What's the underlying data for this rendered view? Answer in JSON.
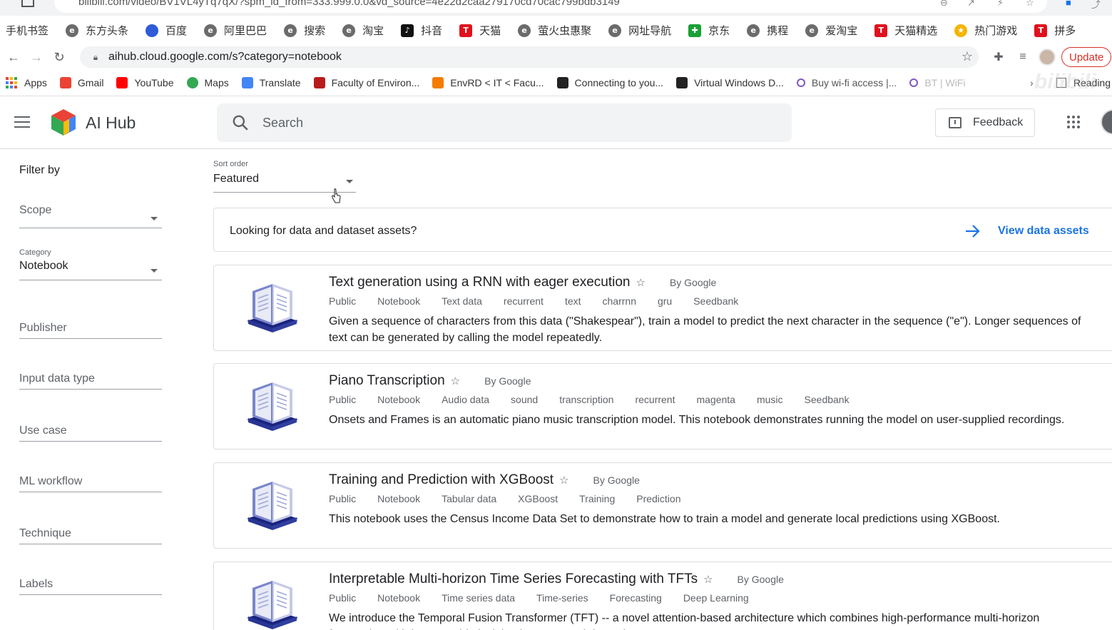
{
  "browser": {
    "prev_tab_url": "bilibili.com/video/BV1VL4yTq7qX/?spm_id_from=333.999.0.0&vd_source=4e22d2caa279170cd70cac799bdb3149",
    "cn_bookmarks": [
      {
        "label": "手机书签",
        "icon": "none"
      },
      {
        "label": "东方头条",
        "icon": "gray"
      },
      {
        "label": "百度",
        "icon": "blue"
      },
      {
        "label": "阿里巴巴",
        "icon": "gray"
      },
      {
        "label": "搜索",
        "icon": "gray"
      },
      {
        "label": "淘宝",
        "icon": "gray"
      },
      {
        "label": "抖音",
        "icon": "black"
      },
      {
        "label": "天猫",
        "icon": "red"
      },
      {
        "label": "萤火虫惠聚",
        "icon": "gray"
      },
      {
        "label": "网址导航",
        "icon": "gray"
      },
      {
        "label": "京东",
        "icon": "green"
      },
      {
        "label": "携程",
        "icon": "gray"
      },
      {
        "label": "爱淘宝",
        "icon": "gray"
      },
      {
        "label": "天猫精选",
        "icon": "red"
      },
      {
        "label": "热门游戏",
        "icon": "yellow"
      },
      {
        "label": "拼多",
        "icon": "red"
      }
    ],
    "address": "aihub.cloud.google.com/s?category=notebook",
    "update_label": "Update",
    "bookmarks": [
      {
        "label": "Apps",
        "icon": "apps"
      },
      {
        "label": "Gmail",
        "icon": "gmail"
      },
      {
        "label": "YouTube",
        "icon": "youtube"
      },
      {
        "label": "Maps",
        "icon": "maps"
      },
      {
        "label": "Translate",
        "icon": "translate"
      },
      {
        "label": "Faculty of Environ...",
        "icon": "faculty"
      },
      {
        "label": "EnvRD < IT < Facu...",
        "icon": "envrd"
      },
      {
        "label": "Connecting to you...",
        "icon": "connecting"
      },
      {
        "label": "Virtual Windows D...",
        "icon": "virtual"
      },
      {
        "label": "Buy wi-fi access |...",
        "icon": "wifi"
      },
      {
        "label": "BT | WiFi",
        "icon": "bt"
      }
    ],
    "reading_list": "Reading"
  },
  "header": {
    "app_title": "AI Hub",
    "search_placeholder": "Search",
    "feedback_label": "Feedback"
  },
  "filters": {
    "title": "Filter by",
    "scope": "Scope",
    "category_caption": "Category",
    "category_value": "Notebook",
    "publisher": "Publisher",
    "input_data_type": "Input data type",
    "use_case": "Use case",
    "ml_workflow": "ML workflow",
    "technique": "Technique",
    "labels": "Labels"
  },
  "sort": {
    "caption": "Sort order",
    "value": "Featured"
  },
  "banner": {
    "question": "Looking for data and dataset assets?",
    "link": "View data assets"
  },
  "assets": [
    {
      "title": "Text generation using a RNN with eager execution",
      "by": "By Google",
      "tags": [
        "Public",
        "Notebook",
        "Text data",
        "recurrent",
        "text",
        "charrnn",
        "gru",
        "Seedbank"
      ],
      "description": "Given a sequence of characters from this data (\"Shakespear\"), train a model to predict the next character in the sequence (\"e\"). Longer sequences of text can be generated by calling the model repeatedly."
    },
    {
      "title": "Piano Transcription",
      "by": "By Google",
      "tags": [
        "Public",
        "Notebook",
        "Audio data",
        "sound",
        "transcription",
        "recurrent",
        "magenta",
        "music",
        "Seedbank"
      ],
      "description": "Onsets and Frames is an automatic piano music transcription model. This notebook demonstrates running the model on user-supplied recordings."
    },
    {
      "title": "Training and Prediction with XGBoost",
      "by": "By Google",
      "tags": [
        "Public",
        "Notebook",
        "Tabular data",
        "XGBoost",
        "Training",
        "Prediction"
      ],
      "description": "This notebook uses the Census Income Data Set to demonstrate how to train a model and generate local predictions using XGBoost."
    },
    {
      "title": "Interpretable Multi-horizon Time Series Forecasting with TFTs",
      "by": "By Google",
      "tags": [
        "Public",
        "Notebook",
        "Time series data",
        "Time-series",
        "Forecasting",
        "Deep Learning"
      ],
      "description": "We introduce the Temporal Fusion Transformer (TFT) -- a novel attention-based architecture which combines high-performance multi-horizon forecasting with interpretable insights into temporal dynamics."
    }
  ],
  "colors": {
    "accent": "#1a73e8",
    "update_red": "#d93025",
    "notebook_icon": "#3f51b5"
  }
}
